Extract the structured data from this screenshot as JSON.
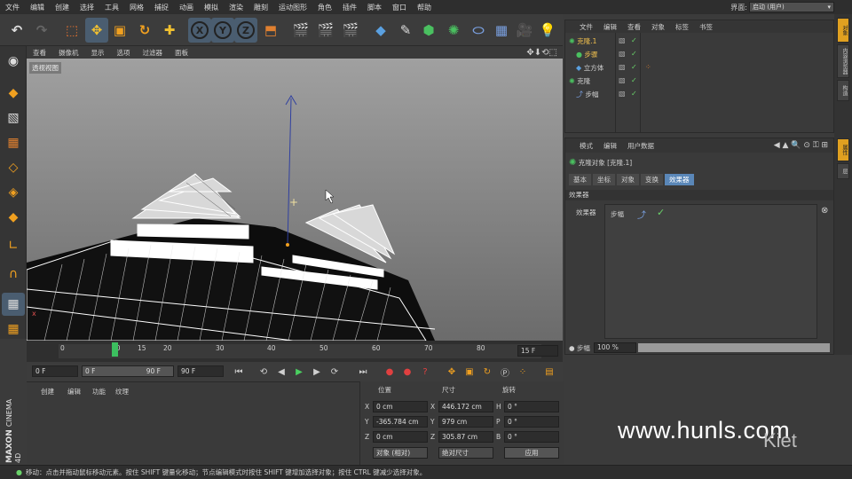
{
  "menubar": {
    "items": [
      "文件",
      "编辑",
      "创建",
      "选择",
      "工具",
      "网格",
      "捕捉",
      "动画",
      "模拟",
      "渲染",
      "雕刻",
      "运动图形",
      "角色",
      "插件",
      "脚本",
      "窗口",
      "帮助"
    ],
    "layout_label": "界面:",
    "layout_value": "启动 (用户)"
  },
  "viewport": {
    "menu": [
      "查看",
      "摄像机",
      "显示",
      "选项",
      "过滤器",
      "面板"
    ],
    "label": "透视视图"
  },
  "timeline": {
    "ticks": [
      "0",
      "10",
      "15",
      "20",
      "30",
      "40",
      "50",
      "60",
      "70",
      "80",
      "90"
    ],
    "current_frame": "15",
    "end_display": "15 F",
    "start_field": "0 F",
    "min_field": "0 F",
    "max_field": "90 F",
    "end_field": "90 F"
  },
  "matpanel": {
    "menu": [
      "创建",
      "编辑",
      "功能",
      "纹理"
    ]
  },
  "coords": {
    "headers": [
      "位置",
      "尺寸",
      "旋转"
    ],
    "rows": [
      {
        "axis": "X",
        "pos": "0 cm",
        "size_axis": "X",
        "size": "446.172 cm",
        "rot_axis": "H",
        "rot": "0 °"
      },
      {
        "axis": "Y",
        "pos": "-365.784 cm",
        "size_axis": "Y",
        "size": "979 cm",
        "rot_axis": "P",
        "rot": "0 °"
      },
      {
        "axis": "Z",
        "pos": "0 cm",
        "size_axis": "Z",
        "size": "305.87 cm",
        "rot_axis": "B",
        "rot": "0 °"
      }
    ],
    "mode1": "对象 (相对)",
    "mode2": "绝对尺寸",
    "apply": "应用"
  },
  "objmgr": {
    "menu": [
      "文件",
      "编辑",
      "查看",
      "对象",
      "标签",
      "书签"
    ],
    "objects": [
      {
        "name": "克隆.1",
        "color": "#f2c14e"
      },
      {
        "name": "步骤",
        "color": "#f2c14e"
      },
      {
        "name": "立方体",
        "color": "#cfcfcf"
      },
      {
        "name": "克隆",
        "color": "#cfcfcf"
      },
      {
        "name": "步幅",
        "color": "#cfcfcf"
      }
    ]
  },
  "attrmgr": {
    "menu": [
      "模式",
      "编辑",
      "用户数据"
    ],
    "title": "克隆对象 [克隆.1]",
    "tabs": [
      "基本",
      "坐标",
      "对象",
      "变换",
      "效果器"
    ],
    "active_tab": "效果器",
    "section": "效果器",
    "field_label": "效果器",
    "effector": "步幅",
    "strength_label": "步幅",
    "strength_value": "100 %",
    "strength": 1.0
  },
  "rightstrip": {
    "tabs": [
      "对象",
      "内容浏览器",
      "构造",
      "属性",
      "层"
    ]
  },
  "status": {
    "text": "移动：点击并拖动鼠标移动元素。按住 SHIFT 键量化移动；节点编辑模式时按住 SHIFT 键增加选择对象；按住 CTRL 键减少选择对象。"
  },
  "branding": {
    "maxon": "MAXON",
    "cinema": "CINEMA 4D",
    "watermark": "www.hunls.com",
    "kiet": "Kiet"
  },
  "colors": {
    "accent_selected": "#4a5d70",
    "active_tab": "#5a87b8",
    "check_green": "#6ad36a",
    "timeline_marker": "#3cbf5f"
  }
}
